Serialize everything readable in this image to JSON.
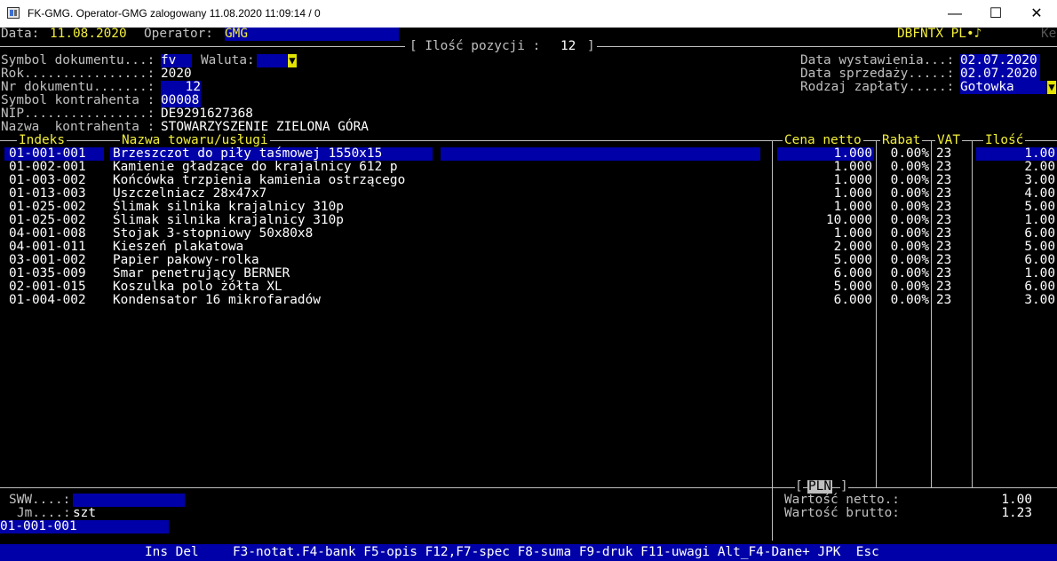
{
  "window": {
    "title": "FK-GMG. Operator-GMG zalogowany 11.08.2020 11:09:14 / 0",
    "minimize": "—",
    "maximize": "☐",
    "close": "✕"
  },
  "header": {
    "data_label": "Data:",
    "data_value": "11.08.2020",
    "operator_label": "Operator:",
    "operator_value": "GMG",
    "right_code": "DBFNTX PL•♪",
    "right_cut": "Ke",
    "positions_label": "[ Ilość pozycji :",
    "positions_value": "12",
    "positions_close": "]"
  },
  "form": {
    "symbol_label": "Symbol dokumentu...:",
    "symbol_value": "fv",
    "waluta_label": "Waluta:",
    "waluta_value": "",
    "rok_label": "Rok................:",
    "rok_value": "2020",
    "nr_label": "Nr dokumentu.......:",
    "nr_value": "12",
    "kontr_symbol_label": "Symbol kontrahenta :",
    "kontr_symbol_value": "00008",
    "nip_label": "NIP................:",
    "nip_value": "DE9291627368",
    "kontr_name_label": "Nazwa  kontrahenta :",
    "kontr_name_value": "STOWARZYSZENIE ZIELONA GÓRA",
    "data_wyst_label": "Data wystawienia...:",
    "data_wyst_value": "02.07.2020",
    "data_sprz_label": "Data sprzedaży.....:",
    "data_sprz_value": "02.07.2020",
    "rodzaj_label": "Rodzaj zapłaty.....:",
    "rodzaj_value": "Gotowka"
  },
  "table": {
    "headers": {
      "indeks": "Indeks",
      "nazwa": "Nazwa towaru/usługi",
      "cena": "Cena netto",
      "rabat": "Rabat",
      "vat": "VAT",
      "ilosc": "Ilość"
    },
    "rows": [
      {
        "indeks": "01-001-001",
        "nazwa": "Brzeszczot do piły taśmowej 1550x15",
        "cena": "1.000",
        "rabat": "0.00%",
        "vat": "23",
        "ilosc": "1.00"
      },
      {
        "indeks": "01-002-001",
        "nazwa": "Kamienie gładzące do krajalnicy 612 p",
        "cena": "1.000",
        "rabat": "0.00%",
        "vat": "23",
        "ilosc": "2.00"
      },
      {
        "indeks": "01-003-002",
        "nazwa": "Końcówka trzpienia kamienia ostrzącego",
        "cena": "1.000",
        "rabat": "0.00%",
        "vat": "23",
        "ilosc": "3.00"
      },
      {
        "indeks": "01-013-003",
        "nazwa": "Uszczelniacz 28x47x7",
        "cena": "1.000",
        "rabat": "0.00%",
        "vat": "23",
        "ilosc": "4.00"
      },
      {
        "indeks": "01-025-002",
        "nazwa": "Ślimak silnika krajalnicy 310p",
        "cena": "1.000",
        "rabat": "0.00%",
        "vat": "23",
        "ilosc": "5.00"
      },
      {
        "indeks": "01-025-002",
        "nazwa": "Ślimak silnika krajalnicy 310p",
        "cena": "10.000",
        "rabat": "0.00%",
        "vat": "23",
        "ilosc": "1.00"
      },
      {
        "indeks": "04-001-008",
        "nazwa": "Stojak 3-stopniowy 50x80x8",
        "cena": "1.000",
        "rabat": "0.00%",
        "vat": "23",
        "ilosc": "6.00"
      },
      {
        "indeks": "04-001-011",
        "nazwa": "Kieszeń plakatowa",
        "cena": "2.000",
        "rabat": "0.00%",
        "vat": "23",
        "ilosc": "5.00"
      },
      {
        "indeks": "03-001-002",
        "nazwa": "Papier pakowy-rolka",
        "cena": "5.000",
        "rabat": "0.00%",
        "vat": "23",
        "ilosc": "6.00"
      },
      {
        "indeks": "01-035-009",
        "nazwa": "Smar penetrujący BERNER",
        "cena": "6.000",
        "rabat": "0.00%",
        "vat": "23",
        "ilosc": "1.00"
      },
      {
        "indeks": "02-001-015",
        "nazwa": "Koszulka polo żółta XL",
        "cena": "5.000",
        "rabat": "0.00%",
        "vat": "23",
        "ilosc": "6.00"
      },
      {
        "indeks": "01-004-002",
        "nazwa": "Kondensator 16 mikrofaradów",
        "cena": "6.000",
        "rabat": "0.00%",
        "vat": "23",
        "ilosc": "3.00"
      }
    ]
  },
  "footer": {
    "sww_label": "SWW....:",
    "sww_value": "",
    "jm_label": "Jm....:",
    "jm_value": "szt",
    "current_index": "01-001-001",
    "currency_open": "[",
    "currency": "PLN",
    "currency_close": "]",
    "netto_label": "Wartość netto.:",
    "netto_value": "1.00",
    "brutto_label": "Wartość brutto:",
    "brutto_value": "1.23"
  },
  "statusbar": {
    "ins_del": "Ins Del",
    "keys": "F3-notat.F4-bank F5-opis F12,F7-spec F8-suma F9-druk F11-uwagi Alt_F4-Dane+ JPK  Esc"
  }
}
